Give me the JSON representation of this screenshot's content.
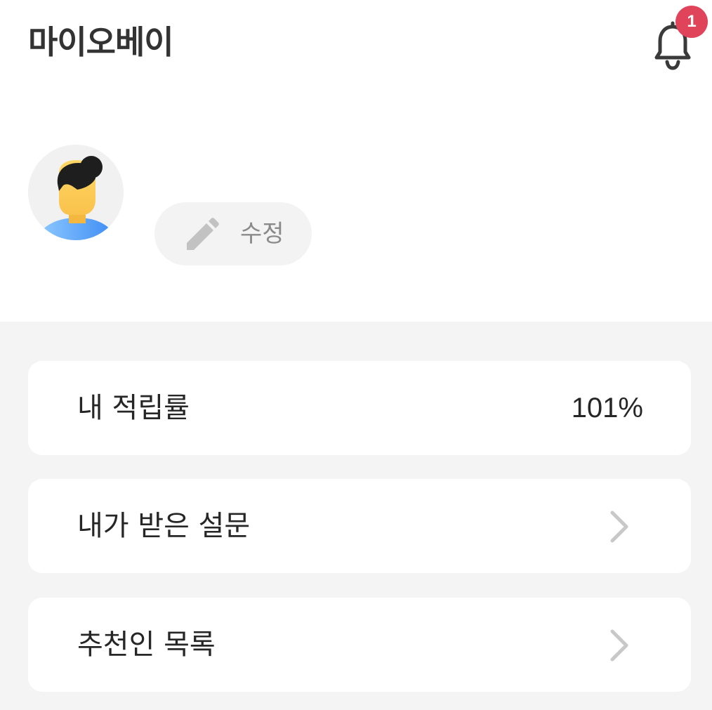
{
  "header": {
    "title": "마이오베이",
    "notification_count": "1",
    "notification_icon": "bell-icon"
  },
  "profile": {
    "avatar_icon": "user-avatar",
    "edit_label": "수정",
    "edit_icon": "pencil-icon"
  },
  "menu": {
    "items": [
      {
        "label": "내 적립률",
        "value": "101%"
      },
      {
        "label": "내가 받은 설문",
        "icon": "chevron-right-icon"
      },
      {
        "label": "추천인 목록",
        "icon": "chevron-right-icon"
      }
    ]
  },
  "colors": {
    "badge": "#e0445b",
    "section_bg": "#f4f4f4",
    "text_primary": "#262626",
    "text_muted": "#8a8a8a",
    "chevron": "#c8c8c8"
  }
}
